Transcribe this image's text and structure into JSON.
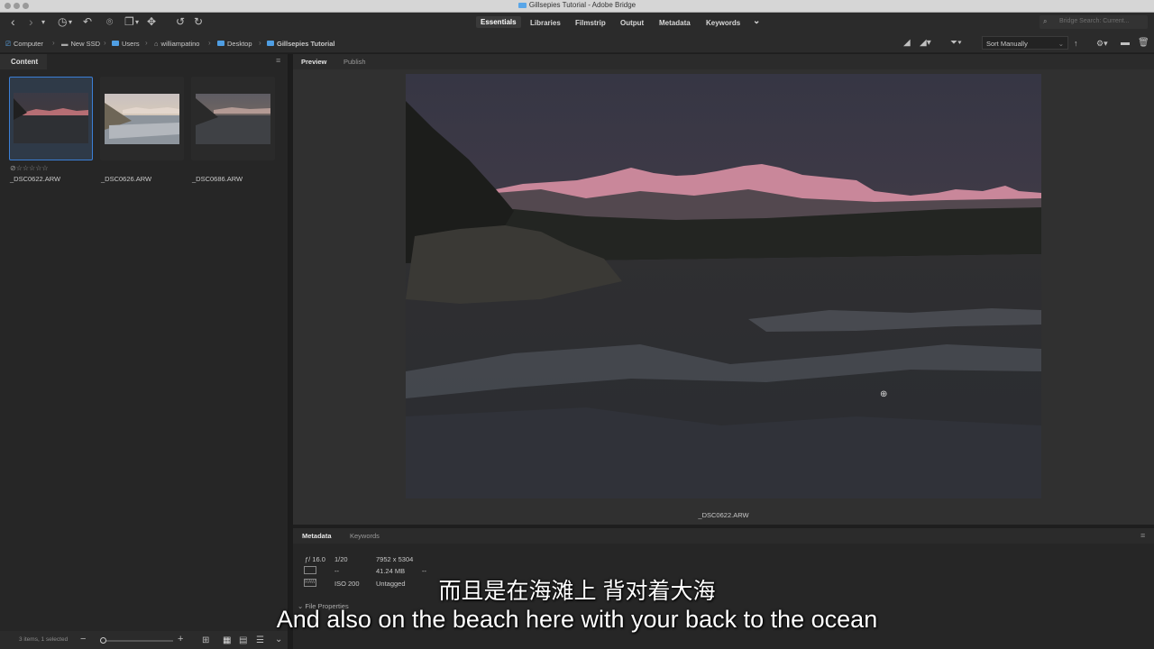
{
  "window": {
    "title": "Gillsepies Tutorial - Adobe Bridge"
  },
  "toolbar": {
    "back_icon": "‹",
    "forward_icon": "›",
    "dropdown_icon": "▾",
    "recent_icon": "◷",
    "boomerang_icon": "↶",
    "camera_icon": "⌾",
    "copy_icon": "❐",
    "refine_icon": "✥",
    "rotate_left_icon": "↺",
    "rotate_right_icon": "↻",
    "workspaces": [
      "Essentials",
      "Libraries",
      "Filmstrip",
      "Output",
      "Metadata",
      "Keywords"
    ],
    "more_icon": "⌄",
    "search_placeholder": "Bridge Search: Current..."
  },
  "path": {
    "crumbs": [
      "Computer",
      "New SSD",
      "Users",
      "williampatino",
      "Desktop",
      "Gillsepies Tutorial"
    ],
    "separator": "›",
    "sort_label": "Sort Manually"
  },
  "content_panel": {
    "tab_label": "Content",
    "menu_icon": "≡",
    "items": [
      {
        "name": "_DSC0622.ARW",
        "selected": true
      },
      {
        "name": "_DSC0626.ARW",
        "selected": false
      },
      {
        "name": "_DSC0686.ARW",
        "selected": false
      }
    ],
    "rating_stars": "⊘☆☆☆☆☆",
    "status": "3 items, 1 selected",
    "zoom_minus": "−",
    "zoom_plus": "+"
  },
  "preview": {
    "tabs": [
      "Preview",
      "Publish"
    ],
    "caption": "_DSC0622.ARW",
    "loupe_icon": "⊕"
  },
  "metadata_panel": {
    "tabs": [
      "Metadata",
      "Keywords"
    ],
    "aperture": "ƒ/ 16.0",
    "shutter": "1/20",
    "dimensions": "7952 x 5304",
    "size": "41.24 MB",
    "meter": "--",
    "iso": "ISO 200",
    "color_label": "Untagged",
    "dash": "--",
    "file_properties": "File Properties"
  },
  "subtitles": {
    "chinese": "而且是在海滩上 背对着大海",
    "english": "And also on the beach here with your back to the ocean"
  }
}
